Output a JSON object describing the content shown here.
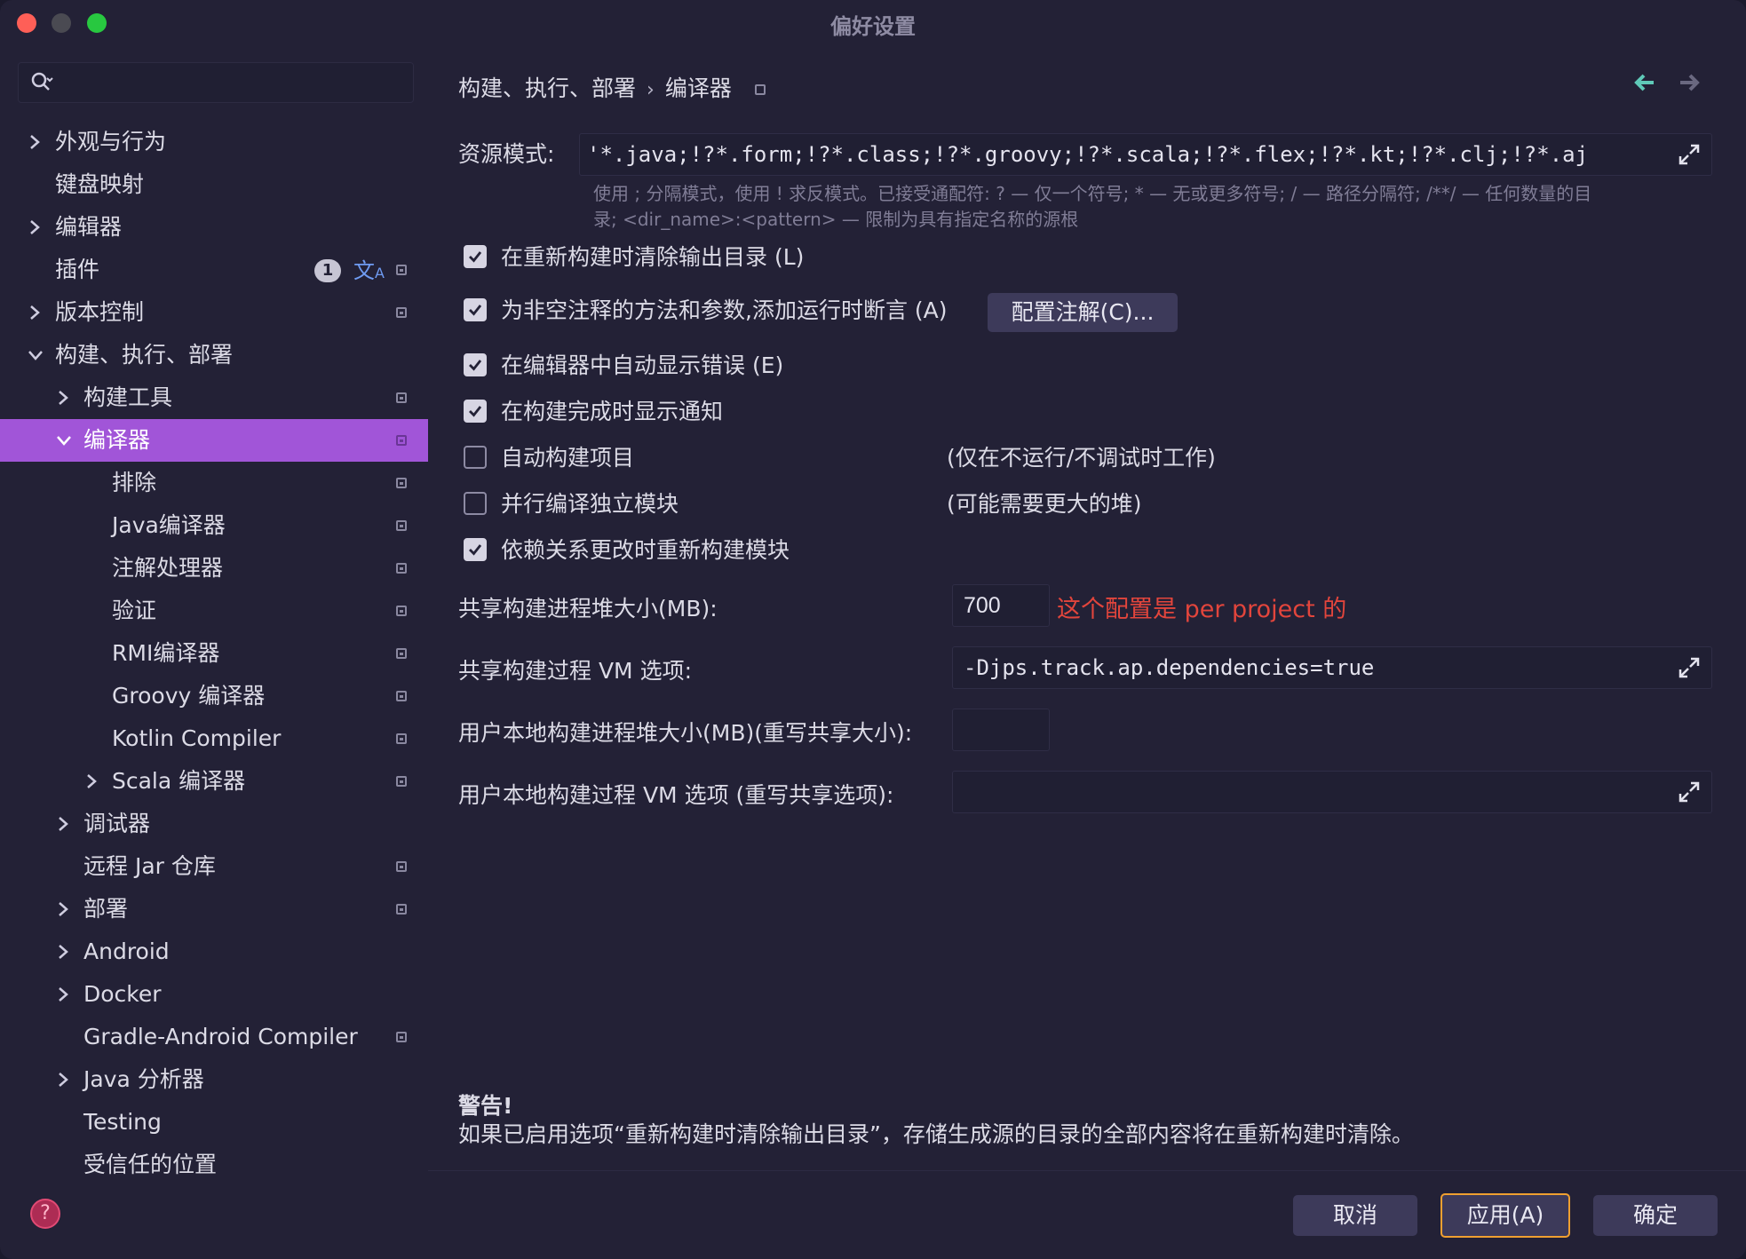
{
  "window": {
    "title": "偏好设置"
  },
  "search": {
    "placeholder": ""
  },
  "sidebar": {
    "items": [
      {
        "label": "外观与行为",
        "chevron": "right",
        "indent": 0,
        "pin": false
      },
      {
        "label": "键盘映射",
        "chevron": "",
        "indent": 0,
        "pin": false
      },
      {
        "label": "编辑器",
        "chevron": "right",
        "indent": 0,
        "pin": false
      },
      {
        "label": "插件",
        "chevron": "",
        "indent": 0,
        "pin": true,
        "badge": "1",
        "translate_icon": "translate-icon"
      },
      {
        "label": "版本控制",
        "chevron": "right",
        "indent": 0,
        "pin": true
      },
      {
        "label": "构建、执行、部署",
        "chevron": "down",
        "indent": 0,
        "pin": false
      },
      {
        "label": "构建工具",
        "chevron": "right",
        "indent": 1,
        "pin": true
      },
      {
        "label": "编译器",
        "chevron": "down",
        "indent": 1,
        "pin": true,
        "selected": true
      },
      {
        "label": "排除",
        "chevron": "",
        "indent": 2,
        "pin": true
      },
      {
        "label": "Java编译器",
        "chevron": "",
        "indent": 2,
        "pin": true
      },
      {
        "label": "注解处理器",
        "chevron": "",
        "indent": 2,
        "pin": true
      },
      {
        "label": "验证",
        "chevron": "",
        "indent": 2,
        "pin": true
      },
      {
        "label": "RMI编译器",
        "chevron": "",
        "indent": 2,
        "pin": true
      },
      {
        "label": "Groovy 编译器",
        "chevron": "",
        "indent": 2,
        "pin": true
      },
      {
        "label": "Kotlin Compiler",
        "chevron": "",
        "indent": 2,
        "pin": true
      },
      {
        "label": "Scala 编译器",
        "chevron": "right",
        "indent": 2,
        "pin": true
      },
      {
        "label": "调试器",
        "chevron": "right",
        "indent": 1,
        "pin": false
      },
      {
        "label": "远程 Jar 仓库",
        "chevron": "",
        "indent": 1,
        "pin": true
      },
      {
        "label": "部署",
        "chevron": "right",
        "indent": 1,
        "pin": true
      },
      {
        "label": "Android",
        "chevron": "right",
        "indent": 1,
        "pin": false
      },
      {
        "label": "Docker",
        "chevron": "right",
        "indent": 1,
        "pin": false
      },
      {
        "label": "Gradle-Android Compiler",
        "chevron": "",
        "indent": 1,
        "pin": true
      },
      {
        "label": "Java 分析器",
        "chevron": "right",
        "indent": 1,
        "pin": false
      },
      {
        "label": "Testing",
        "chevron": "",
        "indent": 1,
        "pin": false
      },
      {
        "label": "受信任的位置",
        "chevron": "",
        "indent": 1,
        "pin": false
      }
    ]
  },
  "breadcrumb": {
    "parent": "构建、执行、部署",
    "separator": "›",
    "current": "编译器"
  },
  "resource": {
    "label": "资源模式:",
    "value": "'*.java;!?*.form;!?*.class;!?*.groovy;!?*.scala;!?*.flex;!?*.kt;!?*.clj;!?*.aj",
    "hint_line1": "使用 ; 分隔模式，使用 ! 求反模式。已接受通配符: ? — 仅一个符号; * — 无或更多符号; / — 路径分隔符; /**/ — 任何数量的目",
    "hint_line2": "录; <dir_name>:<pattern> — 限制为具有指定名称的源根"
  },
  "options": [
    {
      "label": "在重新构建时清除输出目录 (L)",
      "checked": true,
      "note": ""
    },
    {
      "label": "为非空注释的方法和参数,添加运行时断言 (A)",
      "checked": true,
      "note": ""
    },
    {
      "label": "在编辑器中自动显示错误 (E)",
      "checked": true,
      "note": ""
    },
    {
      "label": "在构建完成时显示通知",
      "checked": true,
      "note": ""
    },
    {
      "label": "自动构建项目",
      "checked": false,
      "note": "(仅在不运行/不调试时工作)"
    },
    {
      "label": "并行编译独立模块",
      "checked": false,
      "note": "(可能需要更大的堆)"
    },
    {
      "label": "依赖关系更改时重新构建模块",
      "checked": true,
      "note": ""
    }
  ],
  "configure_annotations_button": "配置注解(C)...",
  "heap": {
    "label": "共享构建进程堆大小(MB):",
    "value": "700",
    "annotation": "这个配置是 per project 的"
  },
  "vm": {
    "label": "共享构建过程 VM 选项:",
    "value": "-Djps.track.ap.dependencies=true"
  },
  "user_heap": {
    "label": "用户本地构建进程堆大小(MB)(重写共享大小):",
    "value": ""
  },
  "user_vm": {
    "label": "用户本地构建过程 VM 选项 (重写共享选项):",
    "value": ""
  },
  "warning": {
    "title": "警告!",
    "text": "如果已启用选项“重新构建时清除输出目录”，存储生成源的目录的全部内容将在重新构建时清除。"
  },
  "footer": {
    "cancel": "取消",
    "apply": "应用(A)",
    "ok": "确定",
    "help": "?"
  },
  "colors": {
    "selection": "#a155d8",
    "annotation_red": "#e2453c",
    "apply_border": "#f0a030",
    "back_arrow": "#5fc9b8"
  }
}
